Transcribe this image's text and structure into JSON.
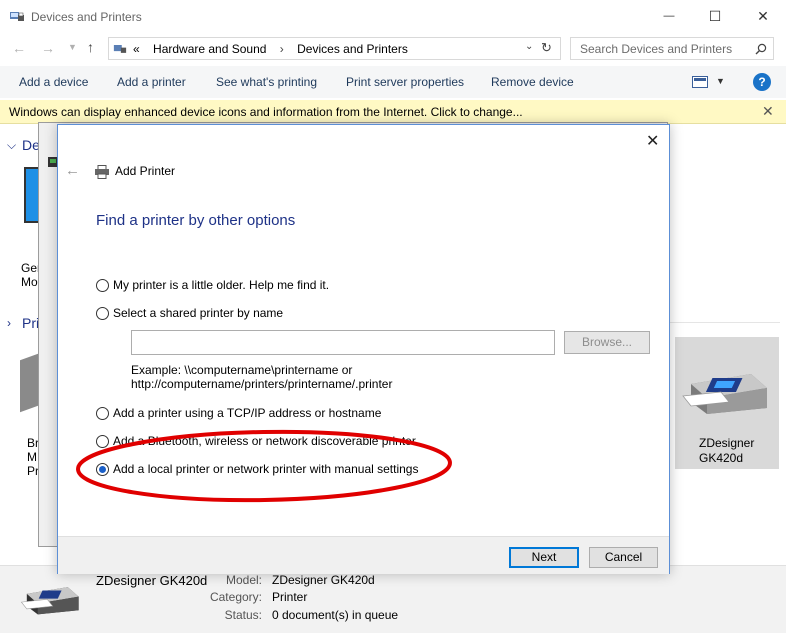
{
  "window": {
    "title": "Devices and Printers",
    "minimize_glyph": "—",
    "maximize_glyph": "☐",
    "close_glyph": "✕"
  },
  "address": {
    "overflow": "«",
    "crumbs": [
      "Hardware and Sound",
      "Devices and Printers"
    ],
    "search_placeholder": "Search Devices and Printers"
  },
  "commands": [
    "Add a device",
    "Add a printer",
    "See what's printing",
    "Print server properties",
    "Remove device"
  ],
  "infobar": {
    "message": "Windows can display enhanced device icons and information from the Internet. Click to change..."
  },
  "groups": [
    {
      "label": "De"
    },
    {
      "label": "Pri"
    }
  ],
  "background_devices": {
    "device1": [
      "Ger",
      "Mo"
    ],
    "printer1": [
      "Br",
      "M",
      "Pr"
    ],
    "selected": [
      "ZDesigner",
      "GK420d"
    ]
  },
  "details": {
    "name": "ZDesigner GK420d",
    "model_key": "Model:",
    "model_value": "ZDesigner GK420d",
    "category_key": "Category:",
    "category_value": "Printer",
    "status_key": "Status:",
    "status_value": "0 document(s) in queue"
  },
  "dialog": {
    "title": "Add Printer",
    "heading": "Find a printer by other options",
    "options": [
      {
        "label": "My printer is a little older. Help me find it.",
        "selected": false
      },
      {
        "label": "Select a shared printer by name",
        "selected": false
      },
      {
        "label": "Add a printer using a TCP/IP address or hostname",
        "selected": false
      },
      {
        "label": "Add a Bluetooth, wireless or network discoverable printer",
        "selected": false
      },
      {
        "label": "Add a local printer or network printer with manual settings",
        "selected": true
      }
    ],
    "shared_name_value": "",
    "browse_label": "Browse...",
    "example_line1": "Example: \\\\computername\\printername or",
    "example_line2": "http://computername/printers/printername/.printer",
    "next_label": "Next",
    "cancel_label": "Cancel"
  },
  "colors": {
    "accent": "#1e3287",
    "infobar": "#fff9c4",
    "annotation": "#e00000",
    "radio_selected": "#1a5fc8"
  }
}
